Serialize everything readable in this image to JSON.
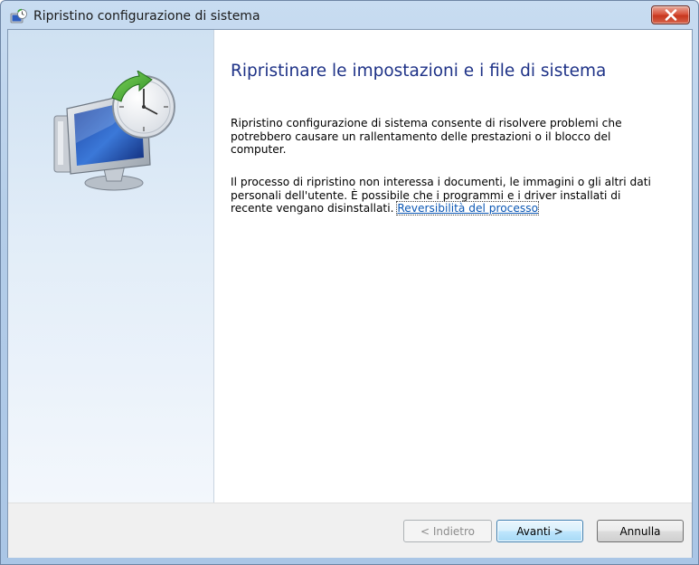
{
  "window": {
    "title": "Ripristino configurazione di sistema"
  },
  "page": {
    "heading": "Ripristinare le impostazioni e i file di sistema",
    "paragraph1": "Ripristino configurazione di sistema consente di risolvere problemi che potrebbero causare un rallentamento delle prestazioni o il blocco del computer.",
    "paragraph2": "Il processo di ripristino non interessa i documenti, le immagini o gli altri dati personali dell'utente. È possibile che i programmi e i driver installati di recente vengano disinstallati.",
    "link": "Reversibilità del processo"
  },
  "buttons": {
    "back": "< Indietro",
    "next": "Avanti >",
    "cancel": "Annulla"
  },
  "icons": {
    "app": "system-restore-icon",
    "hero": "system-restore-illustration",
    "close": "close-icon"
  },
  "colors": {
    "heading": "#1e3287",
    "link": "#0c58b5",
    "close_button": "#c7361d"
  }
}
